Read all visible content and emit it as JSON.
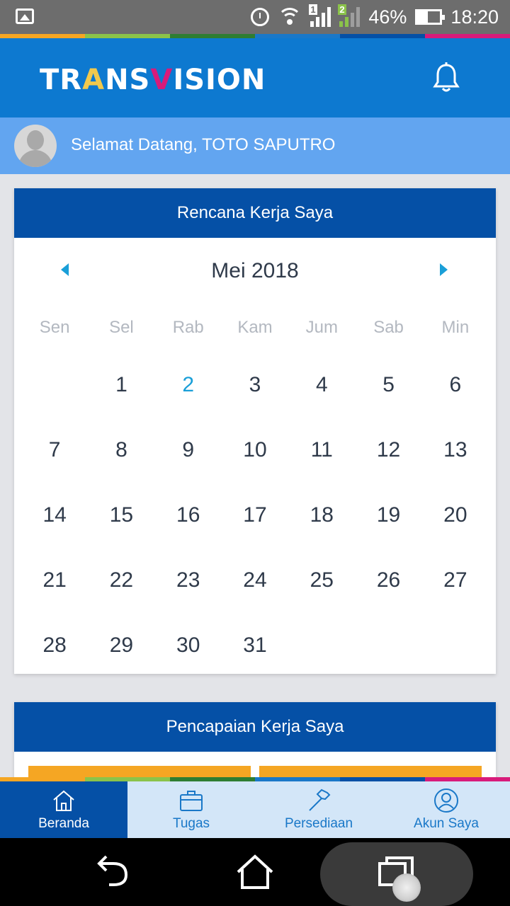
{
  "status_bar": {
    "battery": "46%",
    "time": "18:20",
    "sim1_badge": "1",
    "sim2_badge": "2"
  },
  "header": {
    "brand_part1": "TR",
    "brand_part2": "A",
    "brand_part3": "NS",
    "brand_part4": "V",
    "brand_part5": "ISION"
  },
  "welcome": {
    "text": "Selamat Datang, TOTO SAPUTRO"
  },
  "calendar_card": {
    "title": "Rencana Kerja Saya",
    "month": "Mei 2018",
    "weekdays": [
      "Sen",
      "Sel",
      "Rab",
      "Kam",
      "Jum",
      "Sab",
      "Min"
    ],
    "leading_blanks": 1,
    "days": [
      "1",
      "2",
      "3",
      "4",
      "5",
      "6",
      "7",
      "8",
      "9",
      "10",
      "11",
      "12",
      "13",
      "14",
      "15",
      "16",
      "17",
      "18",
      "19",
      "20",
      "21",
      "22",
      "23",
      "24",
      "25",
      "26",
      "27",
      "28",
      "29",
      "30",
      "31"
    ],
    "today": "2",
    "highlight_color": "#1a9fd8"
  },
  "achievement_card": {
    "title": "Pencapaian Kerja Saya"
  },
  "bottom_nav": {
    "tabs": [
      {
        "label": "Beranda",
        "icon": "home-icon",
        "active": true
      },
      {
        "label": "Tugas",
        "icon": "briefcase-icon",
        "active": false
      },
      {
        "label": "Persediaan",
        "icon": "hammer-icon",
        "active": false
      },
      {
        "label": "Akun Saya",
        "icon": "user-icon",
        "active": false
      }
    ]
  },
  "colors": {
    "appbar": "#0d79d0",
    "welcome_bar": "#62a5f0",
    "card_header": "#0550a6",
    "accent": "#1a9fd8",
    "stripe": [
      "#f5a623",
      "#8bc34a",
      "#2e7d32",
      "#1a78c8",
      "#0550a6",
      "#d81b7a"
    ]
  }
}
